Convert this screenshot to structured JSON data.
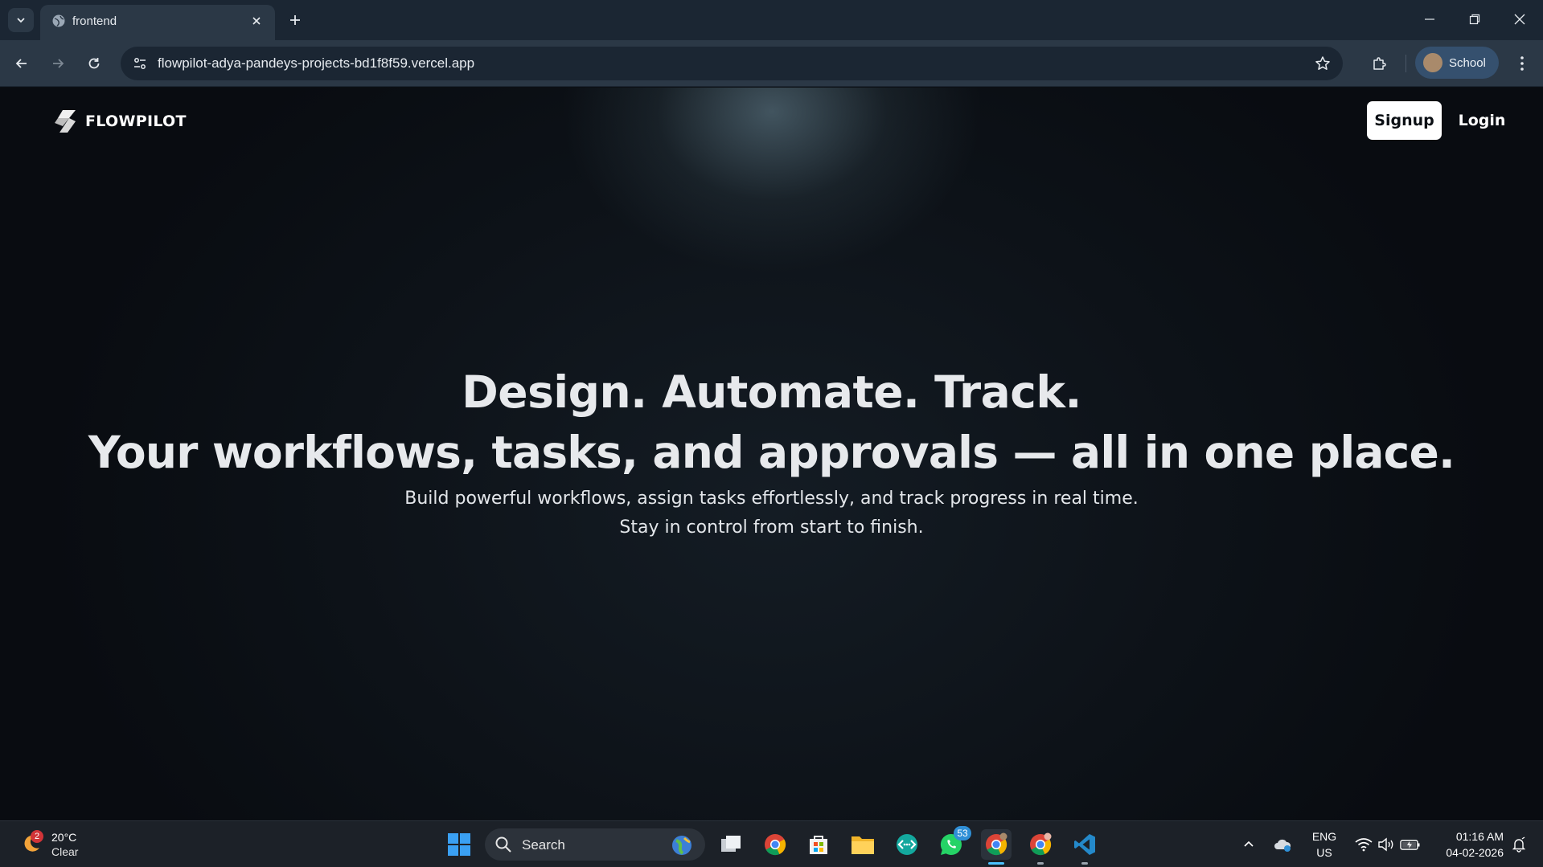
{
  "browser": {
    "tab": {
      "title": "frontend"
    },
    "url": "flowpilot-adya-pandeys-projects-bd1f8f59.vercel.app",
    "profile_label": "School"
  },
  "page": {
    "brand": "FLOWPILOT",
    "nav": {
      "signup_label": "Signup",
      "login_label": "Login"
    },
    "hero": {
      "line1": "Design. Automate. Track.",
      "line2": "Your workflows, tasks, and approvals — all in one place.",
      "sub1": "Build powerful workflows, assign tasks effortlessly, and track progress in real time.",
      "sub2": "Stay in control from start to finish."
    }
  },
  "taskbar": {
    "weather": {
      "badge": "2",
      "temp": "20°C",
      "condition": "Clear"
    },
    "search_label": "Search",
    "whatsapp_badge": "53",
    "tray": {
      "lang": "ENG",
      "region": "US"
    },
    "clock": {
      "time": "01:16 AM",
      "date": "04-02-2026"
    }
  },
  "colors": {
    "accent": "#4cc2ff",
    "page_bg": "#0b0f14",
    "chrome_bg": "#2b3846"
  }
}
